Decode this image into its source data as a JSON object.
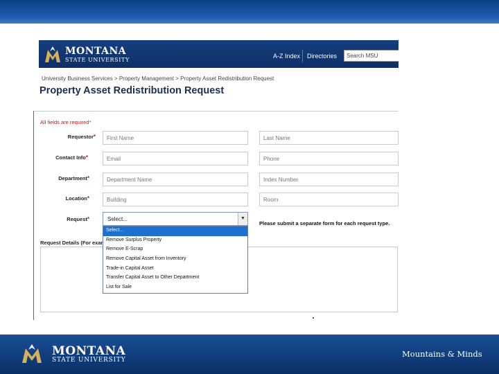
{
  "header": {
    "brand_line1": "MONTANA",
    "brand_line2": "STATE UNIVERSITY",
    "nav_az": "A-Z Index",
    "nav_directories": "Directories",
    "search_placeholder": "Search MSU"
  },
  "breadcrumb": "University Business Services > Property Management > Property Asset Redistribution Request",
  "page_title": "Property Asset Redistribution Request",
  "form": {
    "required_note": "All fields are required*",
    "rows": [
      {
        "label": "Requestor",
        "left_placeholder": "First Name",
        "right_placeholder": "Last Name"
      },
      {
        "label": "Contact Info",
        "left_placeholder": "Email",
        "right_placeholder": "Phone"
      },
      {
        "label": "Department",
        "left_placeholder": "Department Name",
        "right_placeholder": "Index Number"
      },
      {
        "label": "Location",
        "left_placeholder": "Building",
        "right_placeholder": "Room"
      }
    ],
    "request_label": "Request",
    "request_selected": "Select...",
    "request_note": "Please submit a separate form for each request type.",
    "details_label": "Request Details (For exampl",
    "dropdown_options": [
      "Select...",
      "Remove Surplus Property",
      "Remove E-Scrap",
      "Remove Capital Asset from Inventory",
      "Trade-in Capital Asset",
      "Transfer Capital Asset to Other Department",
      "List for Sale"
    ]
  },
  "footer": {
    "brand_line1": "MONTANA",
    "brand_line2": "STATE UNIVERSITY",
    "tagline": "Mountains & Minds"
  },
  "colors": {
    "brand_blue": "#0d2f66",
    "required_red": "#c21a1a",
    "select_highlight": "#1e6fd1",
    "gold": "#d6b15a"
  }
}
